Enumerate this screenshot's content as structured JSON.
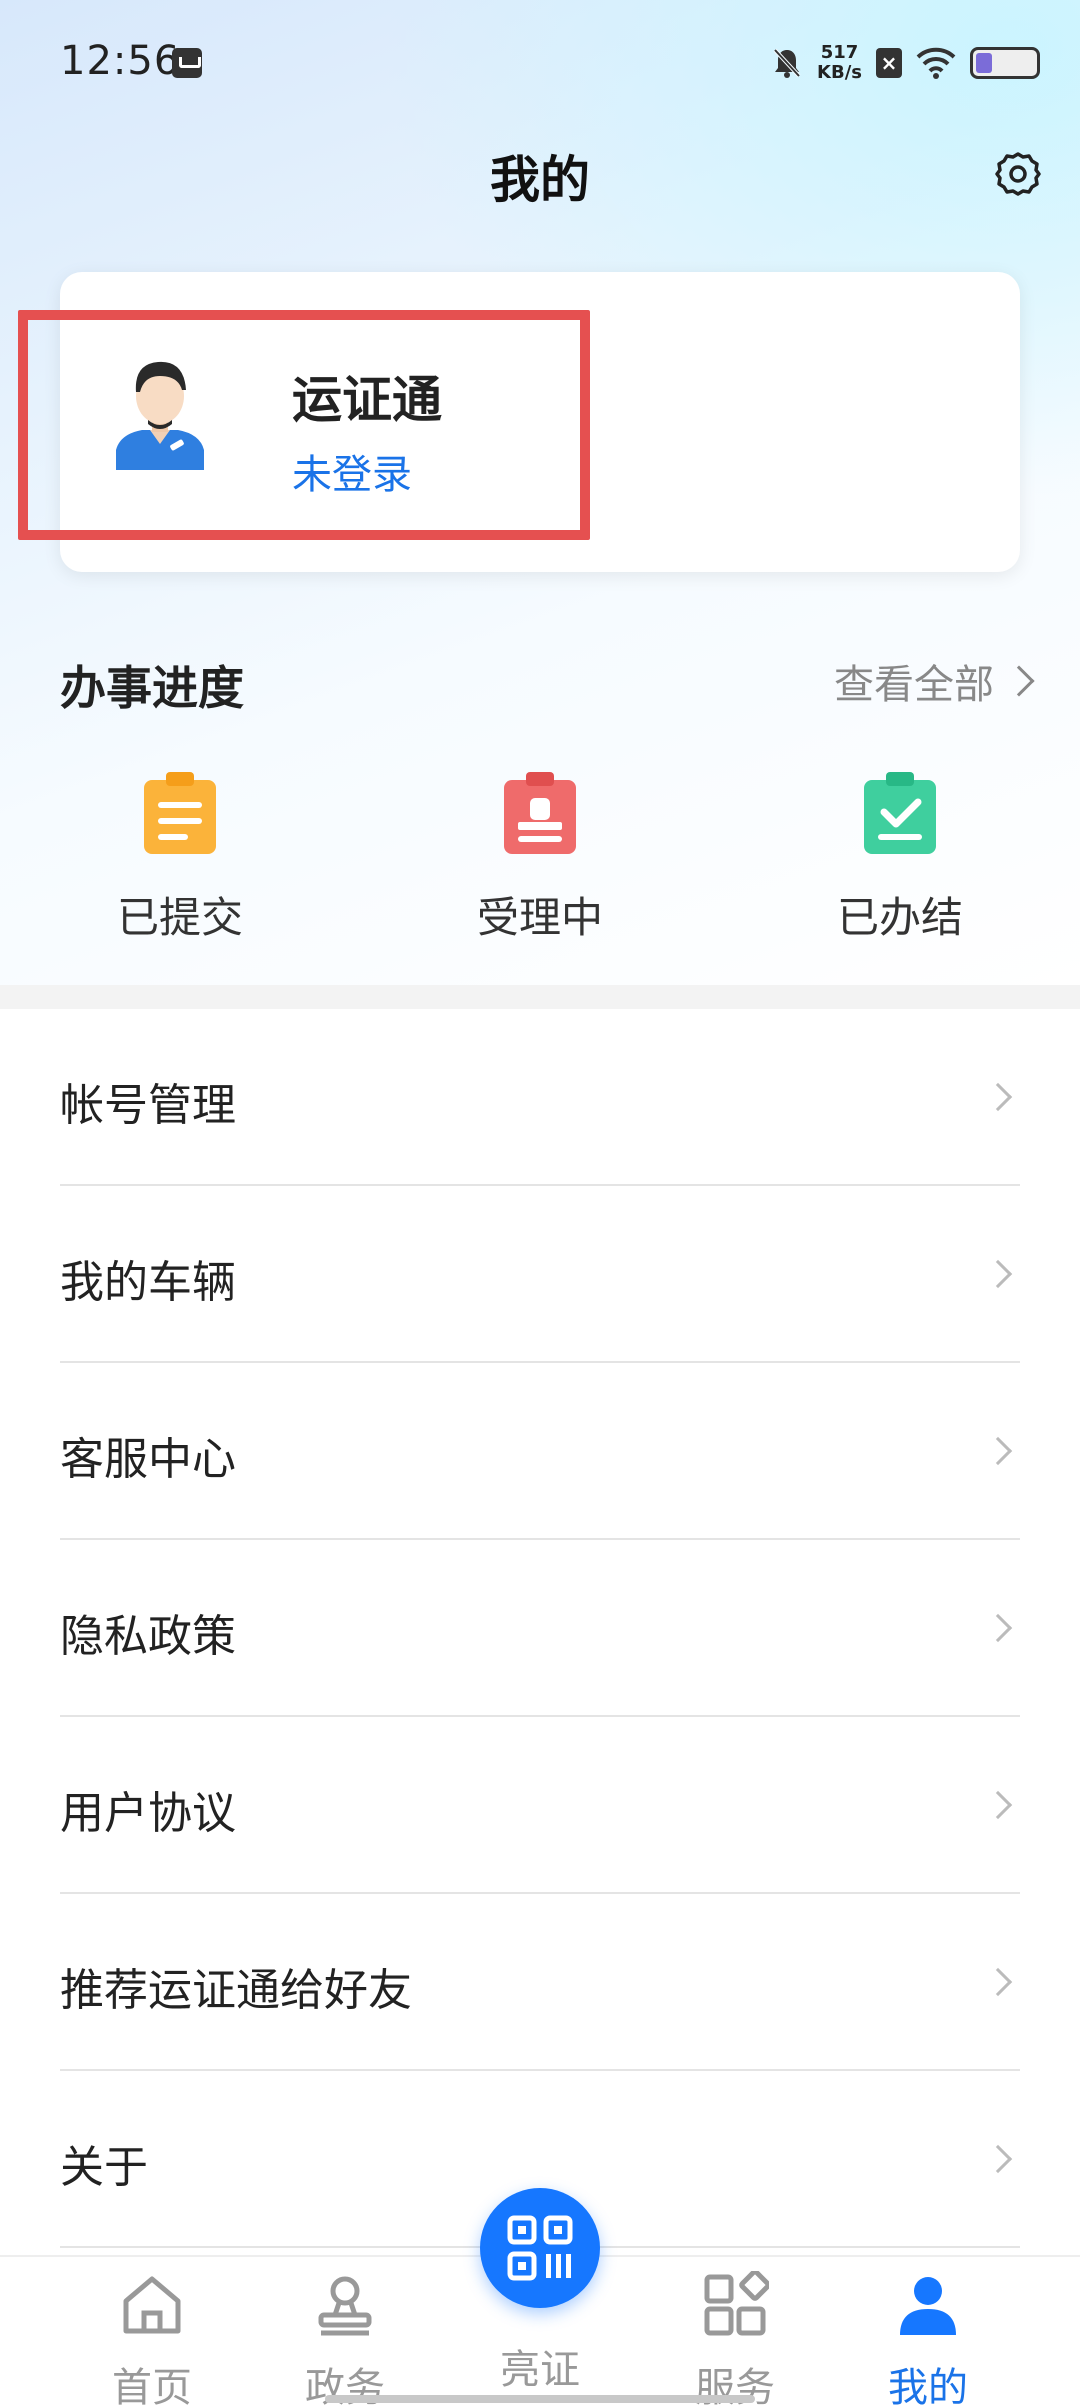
{
  "status_bar": {
    "time": "12:56",
    "net_speed_value": "517",
    "net_speed_unit": "KB/s"
  },
  "header": {
    "title": "我的"
  },
  "profile": {
    "name": "运证通",
    "status": "未登录"
  },
  "progress": {
    "title": "办事进度",
    "view_all": "查看全部",
    "items": [
      {
        "label": "已提交",
        "color": "#fbb33a"
      },
      {
        "label": "受理中",
        "color": "#ef6b6b"
      },
      {
        "label": "已办结",
        "color": "#3fcf9e"
      }
    ]
  },
  "menu": {
    "items": [
      {
        "label": "帐号管理"
      },
      {
        "label": "我的车辆"
      },
      {
        "label": "客服中心"
      },
      {
        "label": "隐私政策"
      },
      {
        "label": "用户协议"
      },
      {
        "label": "推荐运证通给好友"
      },
      {
        "label": "关于"
      }
    ]
  },
  "bottom_nav": {
    "items": [
      {
        "label": "首页",
        "icon": "home-icon"
      },
      {
        "label": "政务",
        "icon": "stamp-icon"
      },
      {
        "label": "亮证",
        "icon": "qr-code-icon"
      },
      {
        "label": "服务",
        "icon": "apps-icon"
      },
      {
        "label": "我的",
        "icon": "user-icon",
        "active": true
      }
    ]
  },
  "colors": {
    "accent": "#1677ff",
    "highlight": "#e55050"
  }
}
